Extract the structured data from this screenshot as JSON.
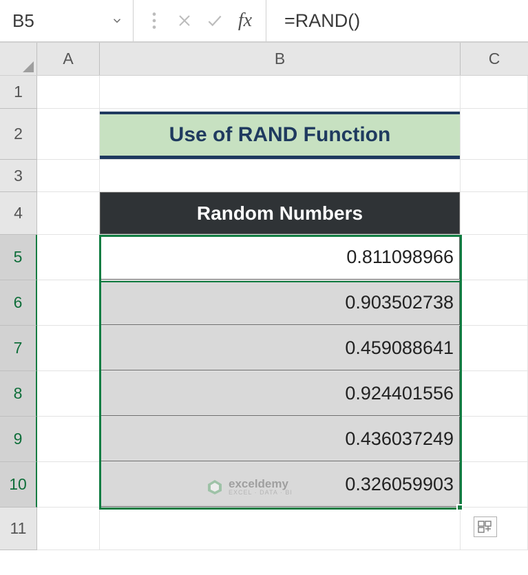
{
  "name_box": "B5",
  "formula": "=RAND()",
  "columns": [
    "A",
    "B",
    "C"
  ],
  "rows": [
    "1",
    "2",
    "3",
    "4",
    "5",
    "6",
    "7",
    "8",
    "9",
    "10",
    "11"
  ],
  "title_banner": "Use of RAND Function",
  "table_header": "Random Numbers",
  "data_values": [
    "0.811098966",
    "0.903502738",
    "0.459088641",
    "0.924401556",
    "0.436037249",
    "0.326059903"
  ],
  "watermark": {
    "brand": "exceldemy",
    "tagline": "EXCEL · DATA · BI"
  },
  "chart_data": {
    "type": "table",
    "title": "Random Numbers",
    "values": [
      0.811098966,
      0.903502738,
      0.459088641,
      0.924401556,
      0.436037249,
      0.326059903
    ]
  }
}
